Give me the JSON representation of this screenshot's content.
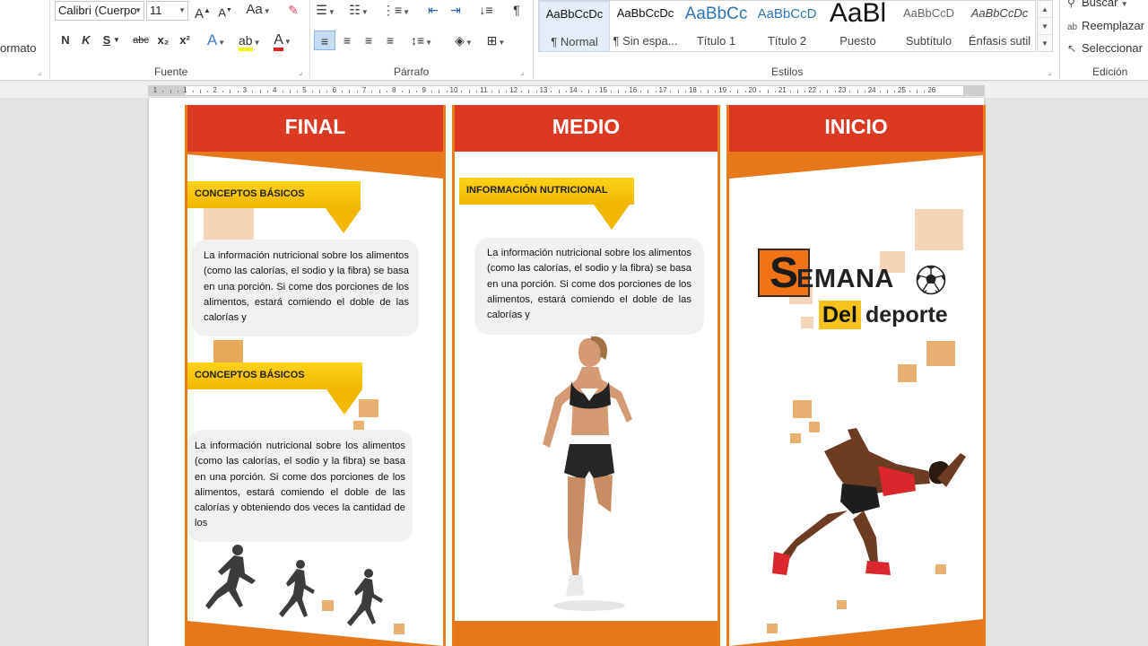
{
  "ribbon": {
    "clipboard": {
      "format_label": "ormato"
    },
    "font": {
      "group_label": "Fuente",
      "font_name": "Calibri (Cuerpo",
      "font_size": "11",
      "grow_icon": "grow-font-icon",
      "shrink_icon": "shrink-font-icon",
      "case_label": "Aa",
      "bold": "N",
      "italic": "K",
      "underline": "S",
      "strike": "abc",
      "subscript": "x₂",
      "superscript": "x²"
    },
    "paragraph": {
      "group_label": "Párrafo"
    },
    "styles": {
      "group_label": "Estilos",
      "items": [
        {
          "sample": "AaBbCcDc",
          "name": "¶ Normal"
        },
        {
          "sample": "AaBbCcDc",
          "name": "¶ Sin espa..."
        },
        {
          "sample": "AaBbCc",
          "name": "Título 1"
        },
        {
          "sample": "AaBbCcD",
          "name": "Título 2"
        },
        {
          "sample": "AaBl",
          "name": "Puesto"
        },
        {
          "sample": "AaBbCcD",
          "name": "Subtítulo"
        },
        {
          "sample": "AaBbCcDc",
          "name": "Énfasis sutil"
        }
      ]
    },
    "editing": {
      "group_label": "Edición",
      "find": "Buscar",
      "replace": "Reemplazar",
      "select": "Seleccionar"
    }
  },
  "ruler": {
    "numbers": [
      "1",
      "1",
      "2",
      "3",
      "4",
      "5",
      "6",
      "7",
      "8",
      "9",
      "10",
      "11",
      "12",
      "13",
      "14",
      "15",
      "16",
      "17",
      "18",
      "19",
      "20",
      "21",
      "22",
      "23",
      "24",
      "25",
      "26"
    ]
  },
  "document": {
    "panels": {
      "final": {
        "title": "FINAL",
        "tag1": "CONCEPTOS BÁSICOS",
        "text1": "La información nutricional sobre los alimentos (como las calorías, el sodio y la fibra) se basa en una porción. Si come dos porciones de los alimentos, estará comiendo el doble de las calorías y",
        "tag2": "CONCEPTOS BÁSICOS",
        "text2": "La información nutricional sobre los alimentos (como las calorías, el sodio y la fibra) se basa en una porción. Si come dos porciones de los alimentos, estará comiendo el doble de las calorías y obteniendo dos veces la cantidad de los"
      },
      "medio": {
        "title": "MEDIO",
        "tag1": "INFORMACIÓN NUTRICIONAL",
        "text1": "La información nutricional sobre los alimentos (como las calorías, el sodio y la fibra) se basa en una porción. Si come dos porciones de los alimentos, estará comiendo el doble de las calorías y"
      },
      "inicio": {
        "title": "INICIO",
        "logo_big_letter": "S",
        "logo_rest": "EMANA",
        "logo_del": "Del",
        "logo_deporte": "deporte"
      }
    }
  },
  "colors": {
    "header_red": "#db3a21",
    "accent_orange": "#e67c1c",
    "tag_yellow": "#f2b700",
    "square_tan": "#eab071"
  }
}
